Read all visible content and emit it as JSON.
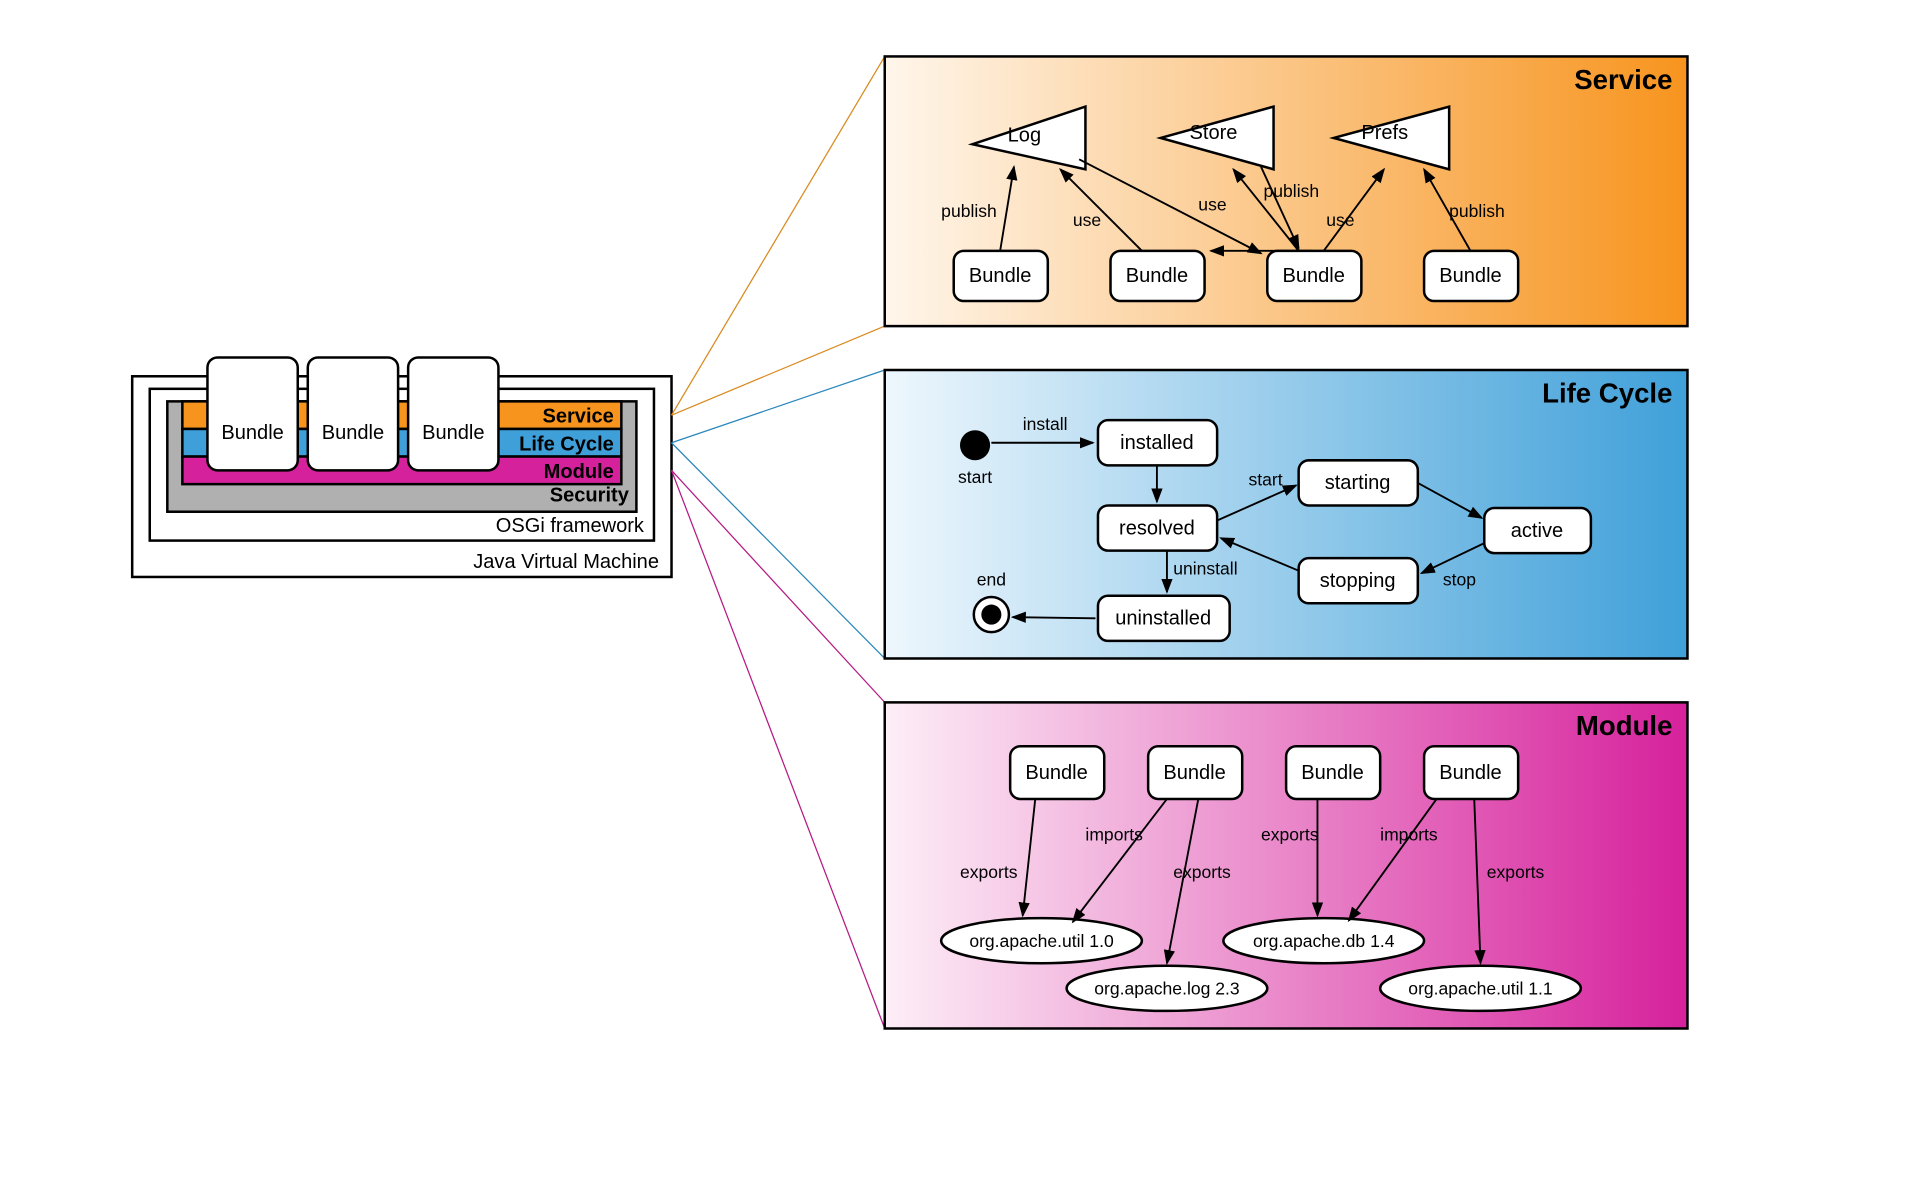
{
  "layers": {
    "service": "Service",
    "lifecycle": "Life Cycle",
    "module": "Module",
    "security": "Security",
    "osgi": "OSGi framework",
    "jvm": "Java Virtual Machine",
    "bundle": "Bundle"
  },
  "service": {
    "title": "Service",
    "nodes": {
      "log": "Log",
      "store": "Store",
      "prefs": "Prefs",
      "bundle": "Bundle"
    },
    "edges": {
      "publish": "publish",
      "use": "use"
    }
  },
  "lifecycle": {
    "title": "Life Cycle",
    "nodes": {
      "start": "start",
      "end": "end",
      "installed": "installed",
      "resolved": "resolved",
      "uninstalled": "uninstalled",
      "starting": "starting",
      "stopping": "stopping",
      "active": "active"
    },
    "edges": {
      "install": "install",
      "start": "start",
      "stop": "stop",
      "uninstall": "uninstall"
    }
  },
  "module": {
    "title": "Module",
    "nodes": {
      "bundle": "Bundle",
      "pkg1": "org.apache.util 1.0",
      "pkg2": "org.apache.log 2.3",
      "pkg3": "org.apache.db 1.4",
      "pkg4": "org.apache.util 1.1"
    },
    "edges": {
      "imports": "imports",
      "exports": "exports"
    }
  },
  "colors": {
    "orange": "#f7941e",
    "blue": "#3fa0d9",
    "magenta": "#d6219c",
    "grey": "#b0b0b0"
  }
}
